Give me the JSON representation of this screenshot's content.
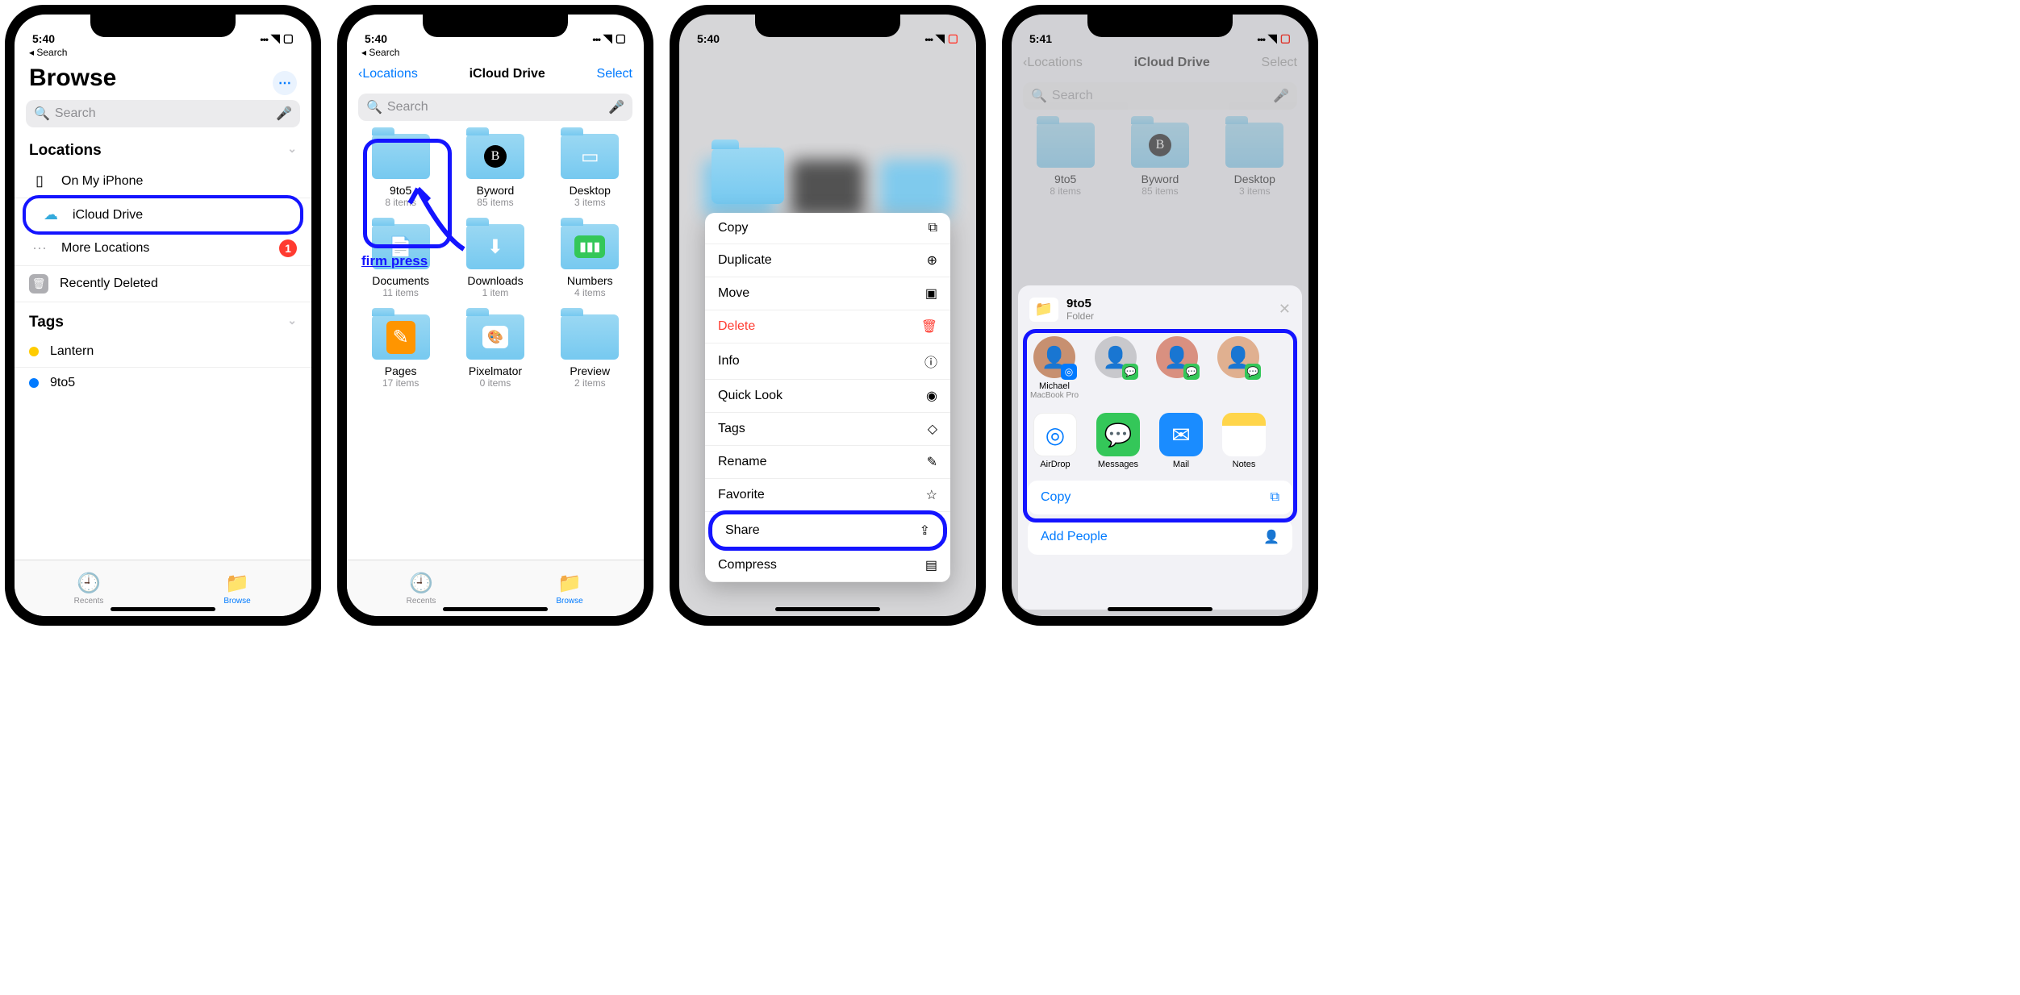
{
  "status": {
    "time1": "5:40",
    "time2": "5:40",
    "time3": "5:40",
    "time4": "5:41",
    "back": "Search"
  },
  "panel1": {
    "title": "Browse",
    "search_ph": "Search",
    "sections": {
      "locations": "Locations",
      "tags": "Tags"
    },
    "rows": {
      "on_iphone": "On My iPhone",
      "icloud": "iCloud Drive",
      "more": "More Locations",
      "badge": "1",
      "deleted": "Recently Deleted"
    },
    "tags": {
      "lantern": "Lantern",
      "nine": "9to5"
    },
    "tabs": {
      "recents": "Recents",
      "browse": "Browse"
    }
  },
  "panel2": {
    "back": "Locations",
    "title": "iCloud Drive",
    "select": "Select",
    "search_ph": "Search",
    "annotation": "firm press",
    "folders": [
      {
        "name": "9to5",
        "count": "8 items",
        "icon": ""
      },
      {
        "name": "Byword",
        "count": "85 items",
        "icon": "B"
      },
      {
        "name": "Desktop",
        "count": "3 items",
        "icon": "win"
      },
      {
        "name": "Documents",
        "count": "11 items",
        "icon": "doc"
      },
      {
        "name": "Downloads",
        "count": "1 item",
        "icon": "down"
      },
      {
        "name": "Numbers",
        "count": "4 items",
        "icon": "num"
      },
      {
        "name": "Pages",
        "count": "17 items",
        "icon": "pages"
      },
      {
        "name": "Pixelmator",
        "count": "0 items",
        "icon": "pix"
      },
      {
        "name": "Preview",
        "count": "2 items",
        "icon": ""
      }
    ]
  },
  "panel3": {
    "menu": [
      {
        "label": "Copy",
        "icon": "⧉"
      },
      {
        "label": "Duplicate",
        "icon": "⊕"
      },
      {
        "label": "Move",
        "icon": "▣"
      },
      {
        "label": "Delete",
        "icon": "🗑",
        "del": true
      },
      {
        "label": "Info",
        "icon": "ⓘ"
      },
      {
        "label": "Quick Look",
        "icon": "◉"
      },
      {
        "label": "Tags",
        "icon": "◇"
      },
      {
        "label": "Rename",
        "icon": "✎"
      },
      {
        "label": "Favorite",
        "icon": "☆"
      },
      {
        "label": "Share",
        "icon": "⇪",
        "hl": true
      },
      {
        "label": "Compress",
        "icon": "▤"
      }
    ]
  },
  "panel4": {
    "back": "Locations",
    "title": "iCloud Drive",
    "select": "Select",
    "search_ph": "Search",
    "folders": [
      {
        "name": "9to5",
        "count": "8 items"
      },
      {
        "name": "Byword",
        "count": "85 items",
        "b": true
      },
      {
        "name": "Desktop",
        "count": "3 items"
      }
    ],
    "sheet": {
      "item_name": "9to5",
      "item_type": "Folder",
      "contacts": [
        {
          "name": "Michael",
          "sub": "MacBook Pro",
          "badge": "airdrop"
        },
        {
          "name": "",
          "sub": "",
          "badge": "msg"
        },
        {
          "name": "",
          "sub": "",
          "badge": "msg"
        },
        {
          "name": "",
          "sub": "",
          "badge": "msg"
        }
      ],
      "apps": [
        {
          "name": "AirDrop",
          "cls": "airdrop",
          "glyph": "◎"
        },
        {
          "name": "Messages",
          "cls": "msg",
          "glyph": "💬"
        },
        {
          "name": "Mail",
          "cls": "mail",
          "glyph": "✉"
        },
        {
          "name": "Notes",
          "cls": "notes",
          "glyph": ""
        }
      ],
      "copy": "Copy",
      "add_people": "Add People"
    }
  }
}
